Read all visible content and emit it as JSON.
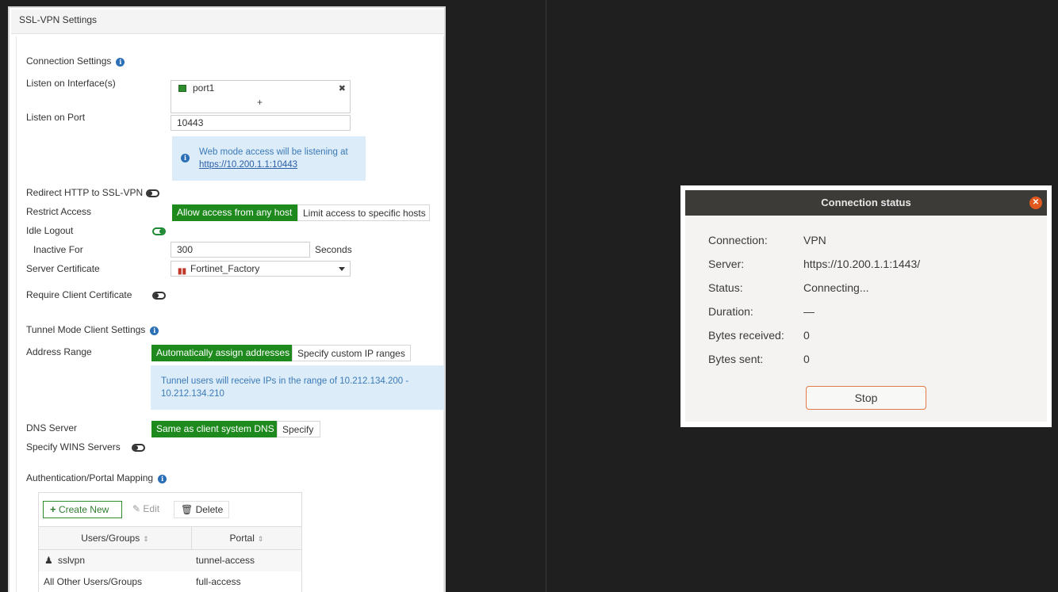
{
  "panel": {
    "title": "SSL-VPN Settings",
    "connection_settings": {
      "section_label": "Connection Settings",
      "listen_interface_label": "Listen on Interface(s)",
      "interfaces": [
        "port1"
      ],
      "add_symbol": "+",
      "remove_symbol": "✖",
      "listen_port_label": "Listen on Port",
      "listen_port_value": "10443",
      "web_mode_info": "Web mode access will be listening at",
      "web_mode_url": "https://10.200.1.1:10443",
      "redirect_label": "Redirect HTTP to SSL-VPN",
      "redirect_enabled": false,
      "restrict_access_label": "Restrict Access",
      "restrict_options": [
        "Allow access from any host",
        "Limit access to specific hosts"
      ],
      "restrict_selected": "Allow access from any host",
      "idle_logout_label": "Idle Logout",
      "idle_logout_enabled": true,
      "inactive_for_label": "Inactive For",
      "inactive_for_value": "300",
      "inactive_for_unit": "Seconds",
      "server_cert_label": "Server Certificate",
      "server_cert_value": "Fortinet_Factory",
      "require_client_cert_label": "Require Client Certificate",
      "require_client_cert_enabled": false
    },
    "tunnel_settings": {
      "section_label": "Tunnel Mode Client Settings",
      "address_range_label": "Address Range",
      "address_options": [
        "Automatically assign addresses",
        "Specify custom IP ranges"
      ],
      "address_selected": "Automatically assign addresses",
      "range_info": "Tunnel users will receive IPs in the range of 10.212.134.200 - 10.212.134.210",
      "dns_label": "DNS Server",
      "dns_options": [
        "Same as client system DNS",
        "Specify"
      ],
      "dns_selected": "Same as client system DNS",
      "wins_label": "Specify WINS Servers",
      "wins_enabled": false
    },
    "auth_mapping": {
      "section_label": "Authentication/Portal Mapping",
      "toolbar": {
        "create_new": "Create New",
        "edit": "Edit",
        "delete": "Delete"
      },
      "columns": [
        "Users/Groups",
        "Portal"
      ],
      "rows": [
        {
          "users": "sslvpn",
          "portal": "tunnel-access"
        },
        {
          "users": "All Other Users/Groups",
          "portal": "full-access"
        }
      ]
    }
  },
  "dialog": {
    "title": "Connection status",
    "fields": [
      {
        "key": "Connection:",
        "value": "VPN"
      },
      {
        "key": "Server:",
        "value": "https://10.200.1.1:1443/"
      },
      {
        "key": "Status:",
        "value": "Connecting..."
      },
      {
        "key": "Duration:",
        "value": "—"
      },
      {
        "key": "Bytes received:",
        "value": "0"
      },
      {
        "key": "Bytes sent:",
        "value": "0"
      }
    ],
    "stop_label": "Stop",
    "close_icon": "close-icon"
  },
  "colors": {
    "accent_green": "#1e8a1e",
    "info_bg": "#dcecf8",
    "dialog_titlebar": "#3d3b38",
    "close_button": "#e1581f",
    "background": "#1f1f1f"
  }
}
